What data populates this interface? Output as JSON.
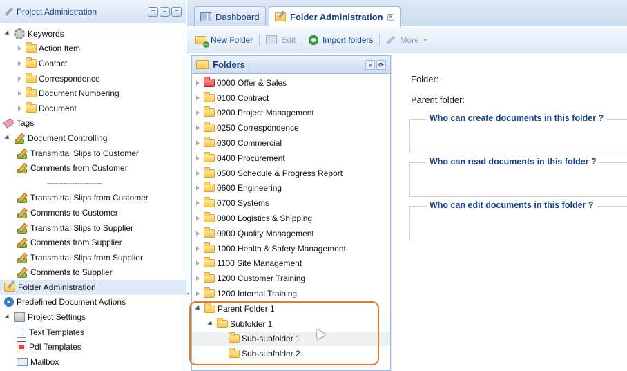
{
  "left_panel": {
    "title": "Project Administration",
    "buttons": [
      "+",
      "=",
      "−"
    ],
    "tree": [
      {
        "label": "Keywords",
        "level": 0,
        "icon": "gear-icon",
        "expander": "expanded"
      },
      {
        "label": "Action Item",
        "level": 1,
        "icon": "folder-icon",
        "expander": "collapsed"
      },
      {
        "label": "Contact",
        "level": 1,
        "icon": "folder-icon",
        "expander": "collapsed"
      },
      {
        "label": "Correspondence",
        "level": 1,
        "icon": "folder-icon",
        "expander": "collapsed"
      },
      {
        "label": "Document Numbering",
        "level": 1,
        "icon": "folder-icon",
        "expander": "collapsed"
      },
      {
        "label": "Document",
        "level": 1,
        "icon": "folder-icon",
        "expander": "collapsed"
      },
      {
        "label": "Tags",
        "level": 0,
        "icon": "tag-icon",
        "expander": "none"
      },
      {
        "label": "Document Controlling",
        "level": 0,
        "icon": "pen-icon",
        "expander": "expanded"
      },
      {
        "label": "Transmittal Slips to Customer",
        "level": 1,
        "icon": "pen-icon",
        "expander": "none"
      },
      {
        "label": "Comments from Customer",
        "level": 1,
        "icon": "pen-icon",
        "expander": "none"
      },
      {
        "label": "--------------------",
        "level": 1,
        "icon": "none",
        "expander": "none"
      },
      {
        "label": "Transmittal Slips from Customer",
        "level": 1,
        "icon": "pen-icon",
        "expander": "none"
      },
      {
        "label": "Comments to Customer",
        "level": 1,
        "icon": "pen-icon",
        "expander": "none"
      },
      {
        "label": "Transmittal Slips to Supplier",
        "level": 1,
        "icon": "pen-icon",
        "expander": "none"
      },
      {
        "label": "Comments from Supplier",
        "level": 1,
        "icon": "pen-icon",
        "expander": "none"
      },
      {
        "label": "Transmittal Slips from Supplier",
        "level": 1,
        "icon": "pen-icon",
        "expander": "none"
      },
      {
        "label": "Comments to Supplier",
        "level": 1,
        "icon": "pen-icon",
        "expander": "none"
      },
      {
        "label": "Folder Administration",
        "level": 0,
        "icon": "folder-admin-icon",
        "expander": "none",
        "selected": true
      },
      {
        "label": "Predefined Document Actions",
        "level": 0,
        "icon": "play-icon",
        "expander": "none"
      },
      {
        "label": "Project Settings",
        "level": 0,
        "icon": "box-icon",
        "expander": "expanded"
      },
      {
        "label": "Text Templates",
        "level": 1,
        "icon": "document-icon",
        "expander": "none"
      },
      {
        "label": "Pdf Templates",
        "level": 1,
        "icon": "pdf-icon",
        "expander": "none"
      },
      {
        "label": "Mailbox",
        "level": 1,
        "icon": "mail-icon",
        "expander": "none"
      }
    ]
  },
  "tabs": [
    {
      "label": "Dashboard",
      "active": false
    },
    {
      "label": "Folder Administration",
      "active": true
    }
  ],
  "toolbar": {
    "new_folder": "New Folder",
    "edit": "Edit",
    "import_folders": "Import folders",
    "more": "More"
  },
  "folders_panel": {
    "title": "Folders",
    "items": [
      {
        "label": "0000 Offer & Sales",
        "level": 0,
        "expander": "collapsed",
        "color": "red"
      },
      {
        "label": "0100 Contract",
        "level": 0,
        "expander": "collapsed"
      },
      {
        "label": "0200 Project Management",
        "level": 0,
        "expander": "collapsed"
      },
      {
        "label": "0250 Correspondence",
        "level": 0,
        "expander": "collapsed"
      },
      {
        "label": "0300 Commercial",
        "level": 0,
        "expander": "collapsed"
      },
      {
        "label": "0400 Procurement",
        "level": 0,
        "expander": "collapsed"
      },
      {
        "label": "0500 Schedule & Progress Report",
        "level": 0,
        "expander": "collapsed"
      },
      {
        "label": "0600 Engineering",
        "level": 0,
        "expander": "collapsed"
      },
      {
        "label": "0700 Systems",
        "level": 0,
        "expander": "collapsed"
      },
      {
        "label": "0800 Logistics & Shipping",
        "level": 0,
        "expander": "collapsed"
      },
      {
        "label": "0900 Quality Management",
        "level": 0,
        "expander": "collapsed"
      },
      {
        "label": "1000 Health & Safety Management",
        "level": 0,
        "expander": "collapsed"
      },
      {
        "label": "1100 Site Management",
        "level": 0,
        "expander": "collapsed"
      },
      {
        "label": "1200 Customer Training",
        "level": 0,
        "expander": "collapsed"
      },
      {
        "label": "1200 Internal Training",
        "level": 0,
        "expander": "collapsed"
      },
      {
        "label": "Parent Folder 1",
        "level": 0,
        "expander": "expanded"
      },
      {
        "label": "Subfolder 1",
        "level": 1,
        "expander": "expanded"
      },
      {
        "label": "Sub-subfolder 1",
        "level": 2,
        "expander": "none",
        "hover": true
      },
      {
        "label": "Sub-subfolder 2",
        "level": 2,
        "expander": "none"
      }
    ]
  },
  "detail": {
    "folder_label": "Folder:",
    "parent_label": "Parent folder:",
    "sections": [
      "Who can create documents in this folder ?",
      "Who can read documents in this folder ?",
      "Who can edit documents in this folder ?"
    ]
  },
  "colors": {
    "accent": "#15428b",
    "highlight": "#e07b22",
    "selected_row": "#dfe8f6"
  }
}
